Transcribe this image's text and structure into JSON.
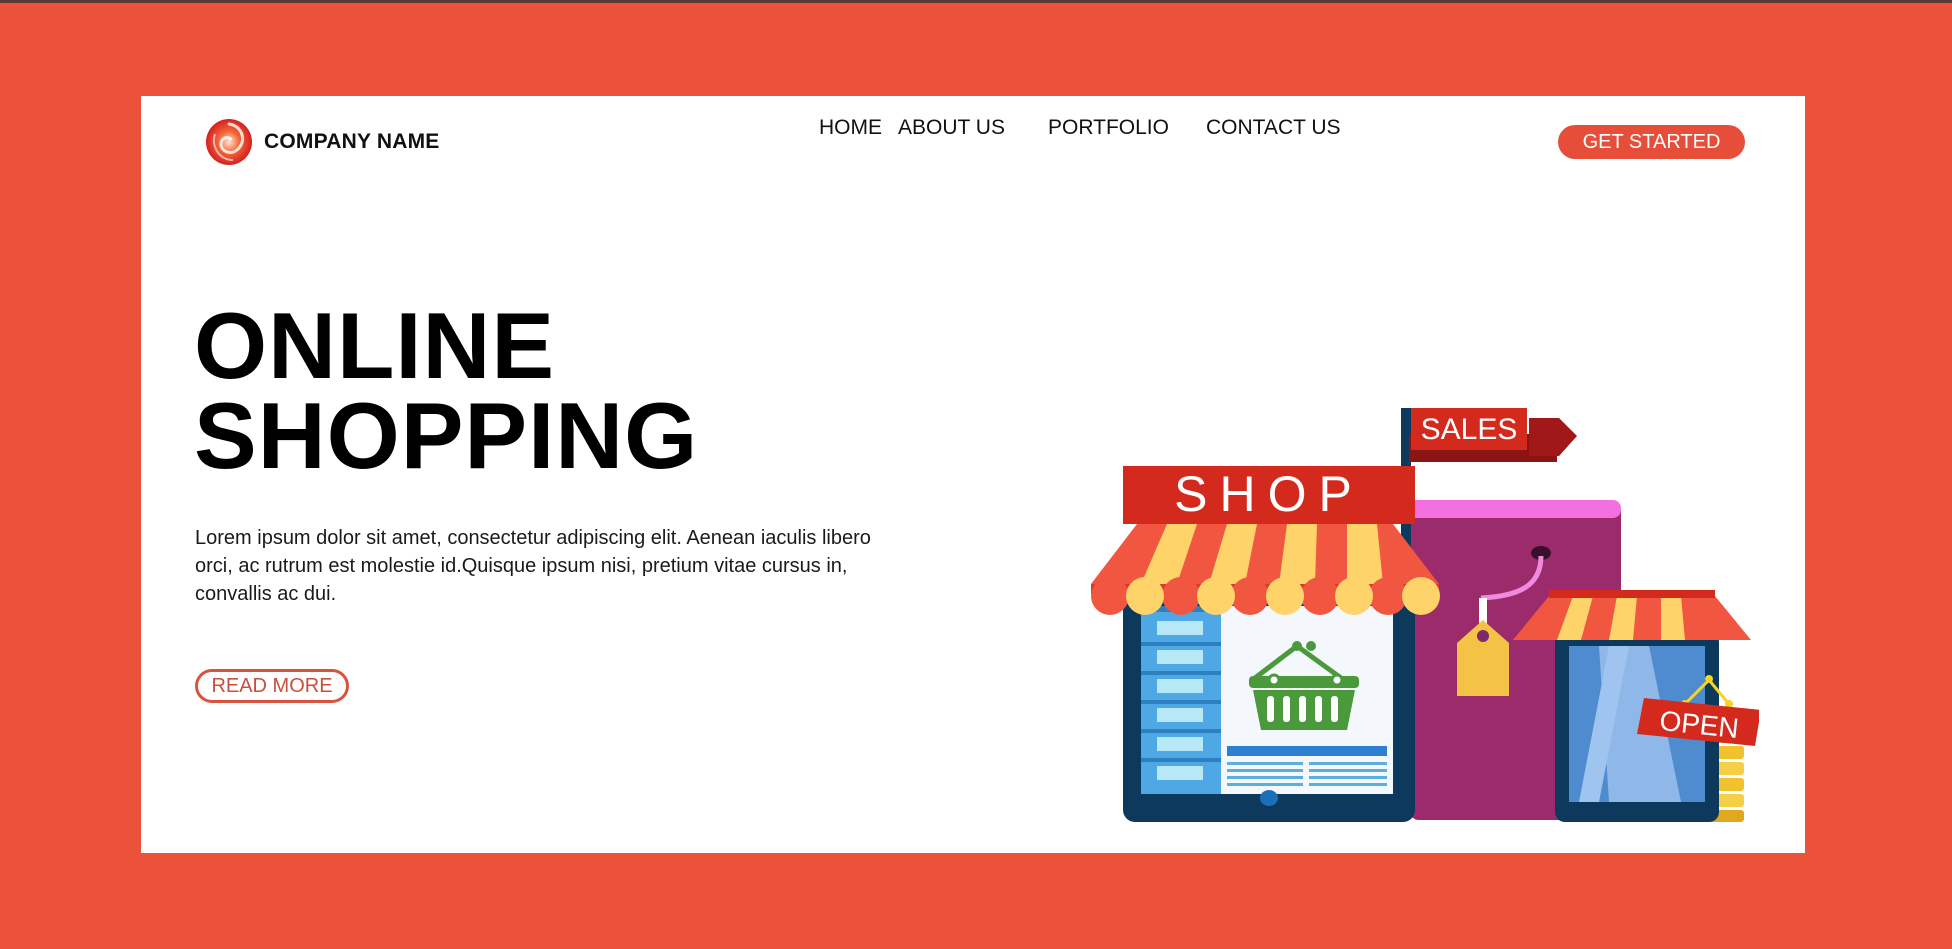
{
  "brand": {
    "name": "COMPANY NAME",
    "logo_icon": "swirl-logo-icon"
  },
  "nav": {
    "items": [
      {
        "label": "HOME"
      },
      {
        "label": "ABOUT US"
      },
      {
        "label": "PORTFOLIO"
      },
      {
        "label": "CONTACT US"
      }
    ],
    "cta_label": "GET STARTED"
  },
  "hero": {
    "title_line1": "ONLINE",
    "title_line2": "SHOPPING",
    "description": "Lorem ipsum dolor sit amet, consectetur adipiscing elit. Aenean iaculis libero orci, ac rutrum est molestie id.Quisque ipsum nisi, pretium vitae cursus in, convallis ac dui.",
    "read_more_label": "READ MORE"
  },
  "illustration": {
    "shop_sign": "SHOP",
    "sales_flag": "SALES",
    "open_sign": "OPEN"
  },
  "colors": {
    "background": "#ec5139",
    "accent": "#e64e3a",
    "card": "#ffffff"
  }
}
